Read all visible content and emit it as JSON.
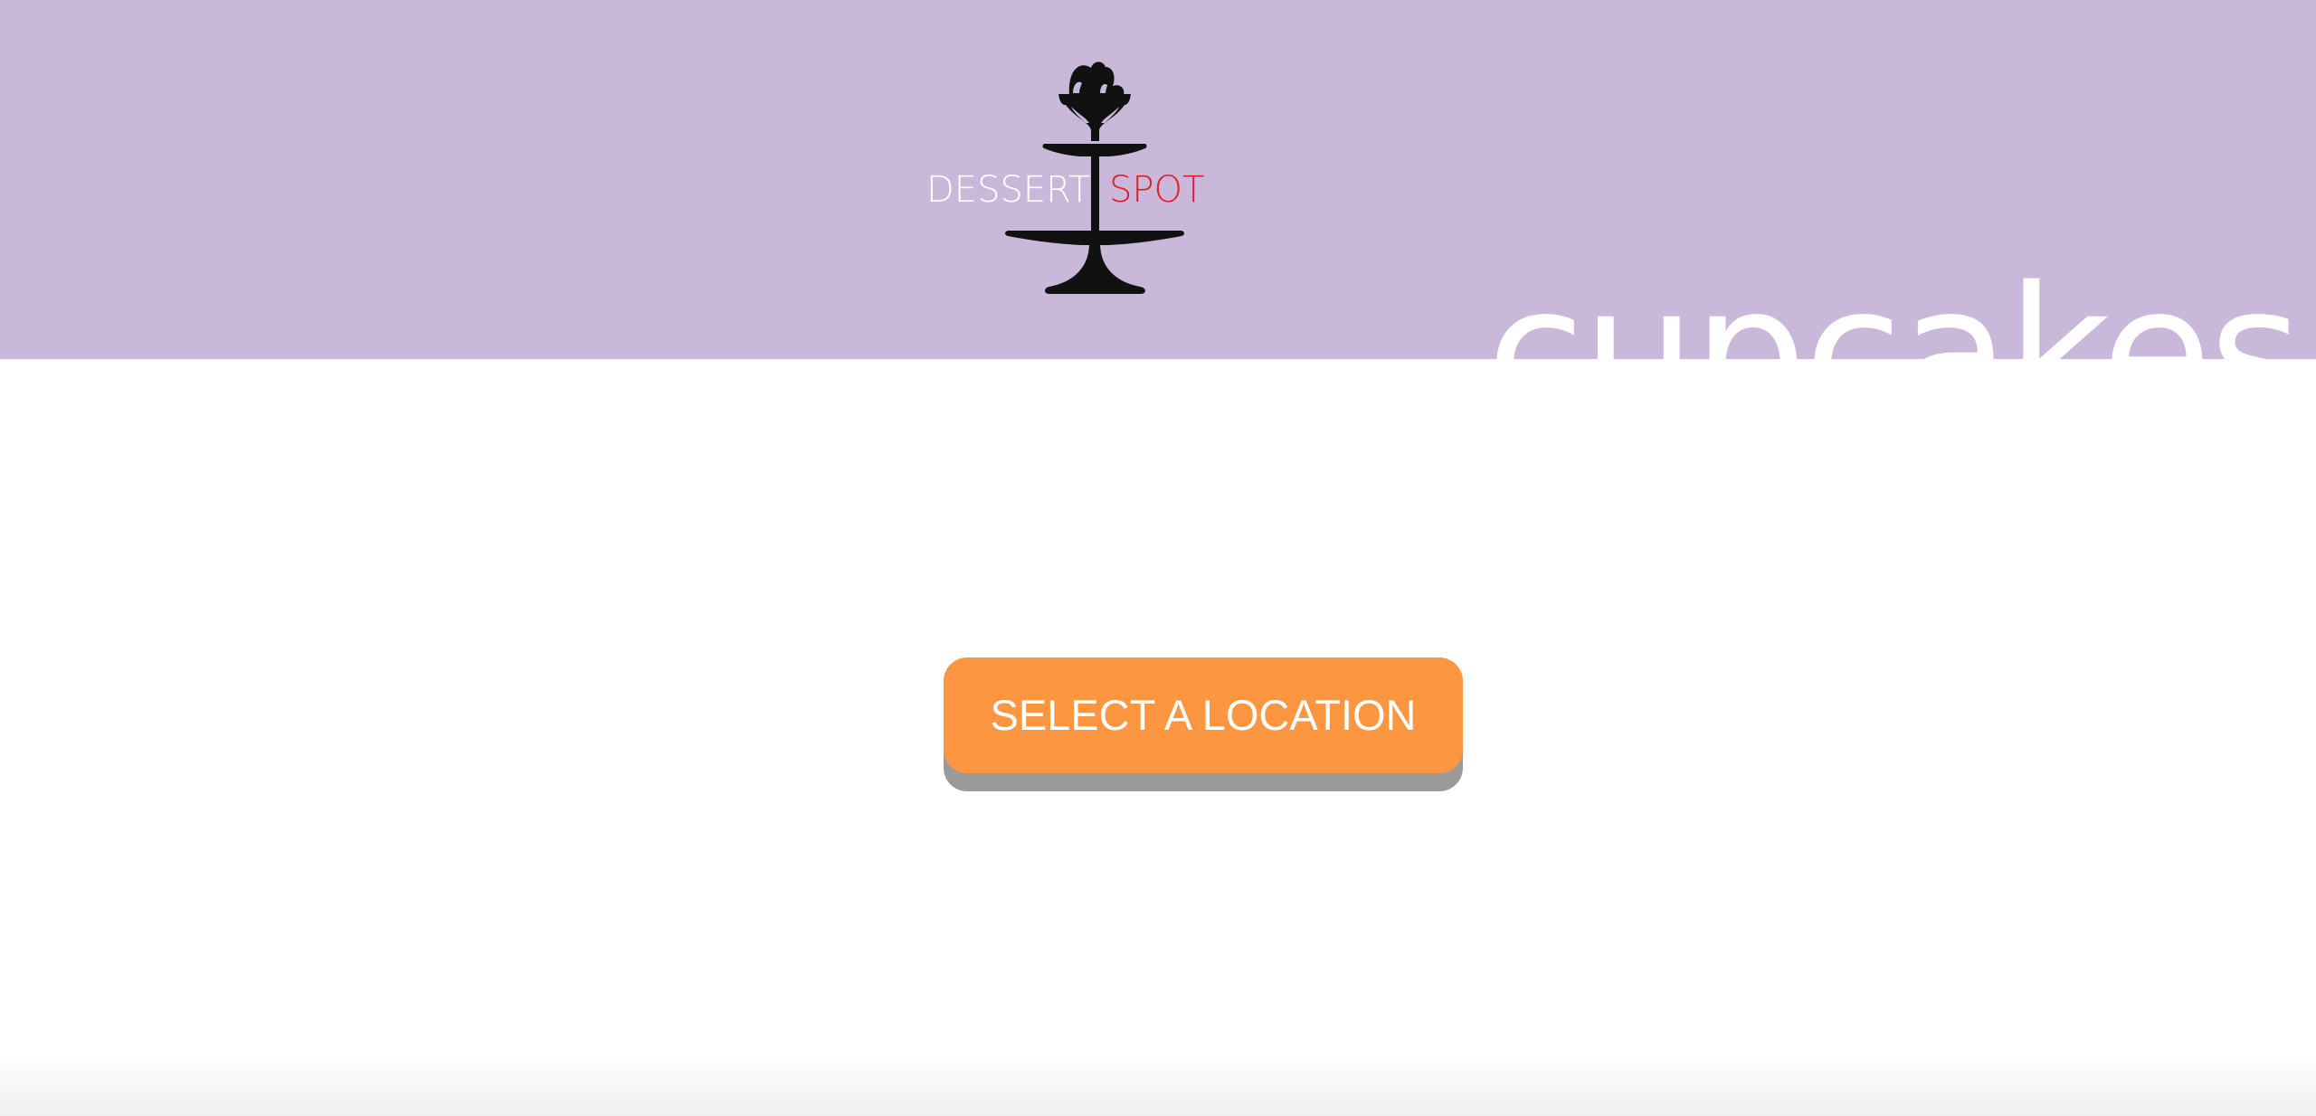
{
  "colors": {
    "header_bg": "#cab8da",
    "header_text": "#ffffff",
    "logo_accent": "#e01d25",
    "logo_dark": "#111111",
    "button_bg": "#fd9640",
    "button_shadow": "#9a9a9a",
    "button_text": "#ffffff"
  },
  "logo": {
    "word_left": "DESSERT",
    "word_right": "SPOT",
    "icon": "cake-stand-icon"
  },
  "header": {
    "section_title": "cupcakes"
  },
  "main": {
    "location_button_label": "SELECT A LOCATION"
  }
}
